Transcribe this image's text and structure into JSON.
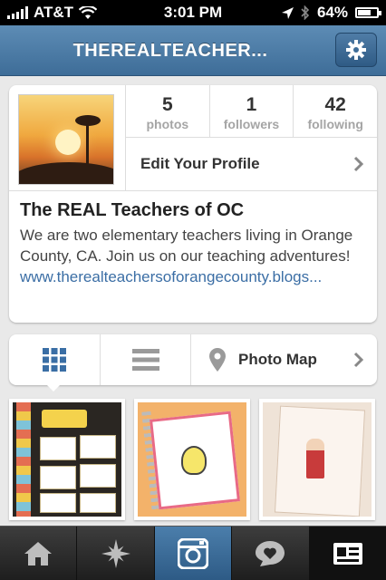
{
  "status_bar": {
    "carrier": "AT&T",
    "time": "3:01 PM",
    "battery": "64%"
  },
  "header": {
    "title": "THEREALTEACHER...",
    "settings_icon": "gear-icon"
  },
  "profile": {
    "stats": [
      {
        "count": "5",
        "label": "photos"
      },
      {
        "count": "1",
        "label": "followers"
      },
      {
        "count": "42",
        "label": "following"
      }
    ],
    "edit_label": "Edit Your Profile",
    "name": "The REAL Teachers of OC",
    "bio": "We are two elementary teachers living in Orange County, CA. Join us on our teaching adventures!",
    "website": "www.therealteachersoforangecounty.blogs..."
  },
  "view_switcher": {
    "grid_icon": "grid-icon",
    "list_icon": "list-icon",
    "map_label": "Photo Map",
    "map_icon": "map-pin-icon"
  },
  "tab_bar": {
    "tabs": [
      "home-icon",
      "explore-icon",
      "camera-icon",
      "activity-icon",
      "profile-icon"
    ],
    "active_index": 2
  },
  "colors": {
    "nav_blue": "#3e6d98",
    "link_blue": "#3b6ea5",
    "grid_active": "#3a6ea5"
  }
}
